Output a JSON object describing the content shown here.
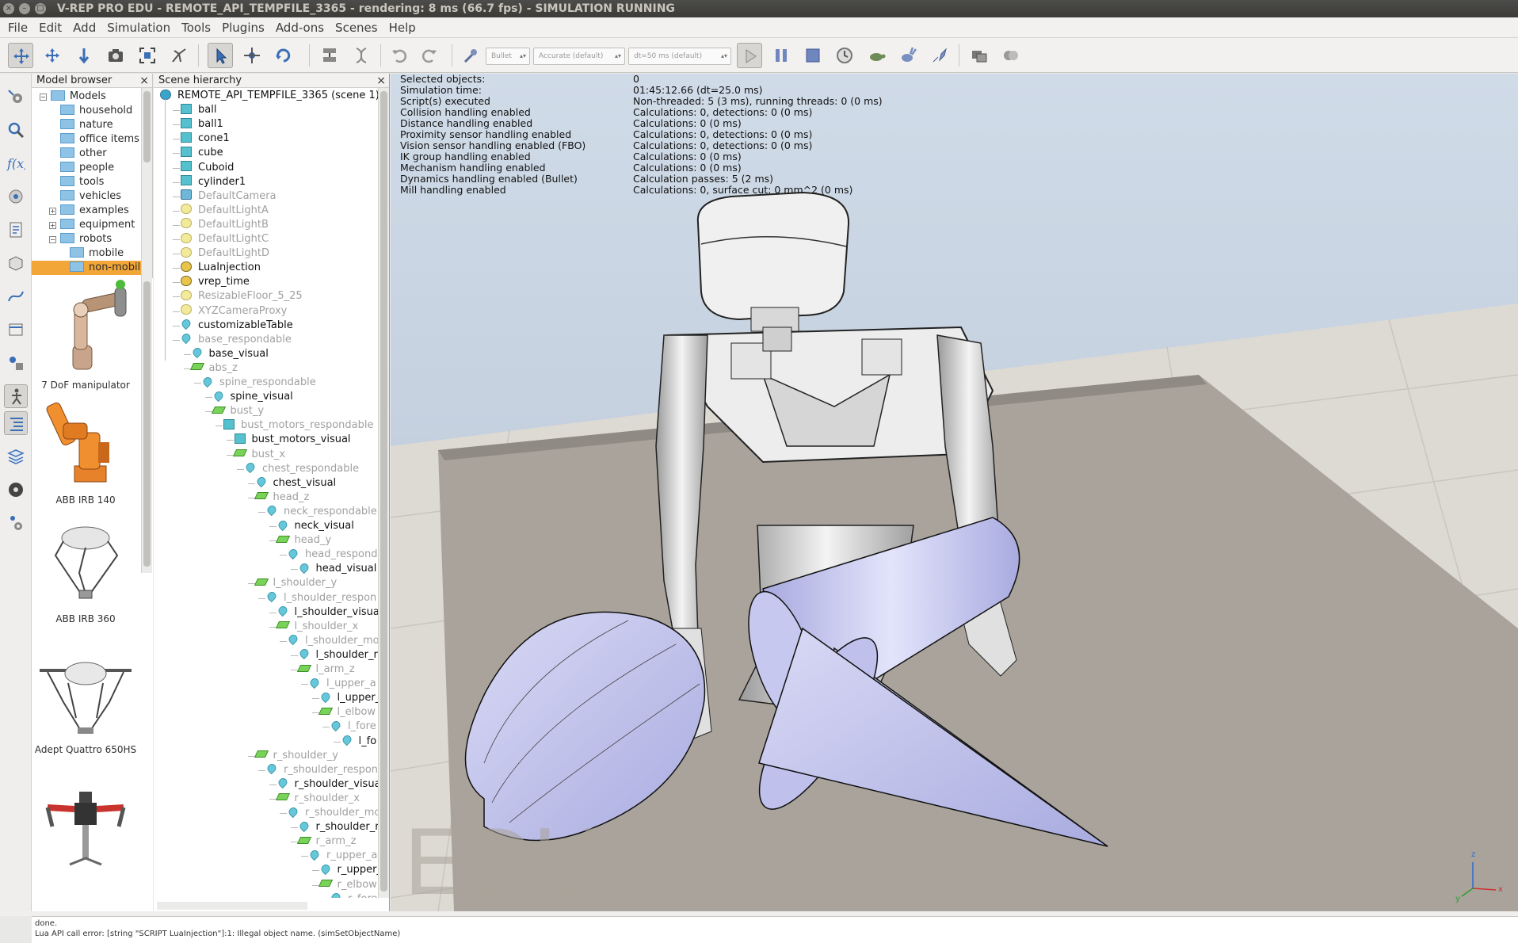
{
  "window": {
    "title": "V-REP PRO EDU - REMOTE_API_TEMPFILE_3365 - rendering: 8 ms (66.7 fps) - SIMULATION RUNNING",
    "close": "×",
    "minimize": "–",
    "maximize": "□"
  },
  "menu": [
    "File",
    "Edit",
    "Add",
    "Simulation",
    "Tools",
    "Plugins",
    "Add-ons",
    "Scenes",
    "Help"
  ],
  "toolbar": {
    "engine": "Bullet",
    "accuracy": "Accurate (default)",
    "timestep": "dt=50 ms (default)",
    "buttons": [
      "camera-pan-icon",
      "camera-rotate-icon",
      "camera-shift-icon",
      "camera-angle-icon",
      "fit-to-view-icon",
      "manipulate-icon",
      "click-select-icon",
      "object-shift-icon",
      "object-rotate-icon",
      "assemble-icon",
      "transfer-dna-icon",
      "undo-icon",
      "redo-icon",
      "dynamics-icon",
      "start-icon",
      "pause-icon",
      "stop-icon",
      "realtime-icon",
      "slower-icon",
      "faster-icon",
      "threaded-rendering-icon",
      "scene-switch-icon",
      "visualization-icon"
    ]
  },
  "model_browser": {
    "title": "Model browser",
    "close": "×",
    "folders": [
      {
        "label": "Models",
        "indent": 0,
        "expanded": true
      },
      {
        "label": "household",
        "indent": 1
      },
      {
        "label": "nature",
        "indent": 1
      },
      {
        "label": "office items",
        "indent": 1
      },
      {
        "label": "other",
        "indent": 1
      },
      {
        "label": "people",
        "indent": 1
      },
      {
        "label": "tools",
        "indent": 1
      },
      {
        "label": "vehicles",
        "indent": 1
      },
      {
        "label": "examples",
        "indent": 1,
        "collapsed": true
      },
      {
        "label": "equipment",
        "indent": 1,
        "collapsed": true
      },
      {
        "label": "robots",
        "indent": 1,
        "expanded": true
      },
      {
        "label": "mobile",
        "indent": 2
      },
      {
        "label": "non-mobile",
        "indent": 2,
        "selected": true
      }
    ],
    "thumbnails": [
      "7 DoF manipulator",
      "ABB IRB 140",
      "ABB IRB 360",
      "Adept Quattro 650HS",
      ""
    ]
  },
  "scene_hierarchy": {
    "title": "Scene hierarchy",
    "close": "×",
    "rows": [
      {
        "label": "REMOTE_API_TEMPFILE_3365 (scene 1)",
        "icon": "scene",
        "depth": 0
      },
      {
        "label": "ball",
        "icon": "shape",
        "depth": 1
      },
      {
        "label": "ball1",
        "icon": "shape",
        "depth": 1
      },
      {
        "label": "cone1",
        "icon": "shape",
        "depth": 1
      },
      {
        "label": "cube",
        "icon": "shape",
        "depth": 1
      },
      {
        "label": "Cuboid",
        "icon": "shape",
        "depth": 1
      },
      {
        "label": "cylinder1",
        "icon": "shape",
        "depth": 1
      },
      {
        "label": "DefaultCamera",
        "icon": "camera",
        "depth": 1,
        "dim": true
      },
      {
        "label": "DefaultLightA",
        "icon": "light",
        "depth": 1,
        "dim": true
      },
      {
        "label": "DefaultLightB",
        "icon": "light",
        "depth": 1,
        "dim": true
      },
      {
        "label": "DefaultLightC",
        "icon": "light",
        "depth": 1,
        "dim": true
      },
      {
        "label": "DefaultLightD",
        "icon": "light",
        "depth": 1,
        "dim": true
      },
      {
        "label": "LuaInjection",
        "icon": "script",
        "depth": 1
      },
      {
        "label": "vrep_time",
        "icon": "script",
        "depth": 1
      },
      {
        "label": "ResizableFloor_5_25",
        "icon": "light",
        "depth": 1,
        "dim": true
      },
      {
        "label": "XYZCameraProxy",
        "icon": "light",
        "depth": 1,
        "dim": true
      },
      {
        "label": "customizableTable",
        "icon": "drop",
        "depth": 1
      },
      {
        "label": "base_respondable",
        "icon": "drop",
        "depth": 1,
        "dim": true
      },
      {
        "label": "base_visual",
        "icon": "drop",
        "depth": 2
      },
      {
        "label": "abs_z",
        "icon": "joint",
        "depth": 2,
        "dim": true
      },
      {
        "label": "spine_respondable",
        "icon": "drop",
        "depth": 3,
        "dim": true
      },
      {
        "label": "spine_visual",
        "icon": "drop",
        "depth": 4
      },
      {
        "label": "bust_y",
        "icon": "joint",
        "depth": 4,
        "dim": true
      },
      {
        "label": "bust_motors_respondable",
        "icon": "shape",
        "depth": 5,
        "dim": true
      },
      {
        "label": "bust_motors_visual",
        "icon": "shape",
        "depth": 6
      },
      {
        "label": "bust_x",
        "icon": "joint",
        "depth": 6,
        "dim": true
      },
      {
        "label": "chest_respondable",
        "icon": "drop",
        "depth": 7,
        "dim": true
      },
      {
        "label": "chest_visual",
        "icon": "drop",
        "depth": 8
      },
      {
        "label": "head_z",
        "icon": "joint",
        "depth": 8,
        "dim": true
      },
      {
        "label": "neck_respondable",
        "icon": "drop",
        "depth": 9,
        "dim": true
      },
      {
        "label": "neck_visual",
        "icon": "drop",
        "depth": 10
      },
      {
        "label": "head_y",
        "icon": "joint",
        "depth": 10,
        "dim": true
      },
      {
        "label": "head_respond",
        "icon": "drop",
        "depth": 11,
        "dim": true
      },
      {
        "label": "head_visual",
        "icon": "drop",
        "depth": 12
      },
      {
        "label": "l_shoulder_y",
        "icon": "joint",
        "depth": 8,
        "dim": true
      },
      {
        "label": "l_shoulder_respon",
        "icon": "drop",
        "depth": 9,
        "dim": true
      },
      {
        "label": "l_shoulder_visua",
        "icon": "drop",
        "depth": 10
      },
      {
        "label": "l_shoulder_x",
        "icon": "joint",
        "depth": 10,
        "dim": true
      },
      {
        "label": "l_shoulder_mo",
        "icon": "drop",
        "depth": 11,
        "dim": true
      },
      {
        "label": "l_shoulder_r",
        "icon": "drop",
        "depth": 12
      },
      {
        "label": "l_arm_z",
        "icon": "joint",
        "depth": 12,
        "dim": true
      },
      {
        "label": "l_upper_a",
        "icon": "drop",
        "depth": 13,
        "dim": true
      },
      {
        "label": "l_upper_",
        "icon": "drop",
        "depth": 14
      },
      {
        "label": "l_elbow",
        "icon": "joint",
        "depth": 14,
        "dim": true
      },
      {
        "label": "l_fore",
        "icon": "drop",
        "depth": 15,
        "dim": true
      },
      {
        "label": "l_fo",
        "icon": "drop",
        "depth": 16
      },
      {
        "label": "r_shoulder_y",
        "icon": "joint",
        "depth": 8,
        "dim": true
      },
      {
        "label": "r_shoulder_respon",
        "icon": "drop",
        "depth": 9,
        "dim": true
      },
      {
        "label": "r_shoulder_visua",
        "icon": "drop",
        "depth": 10
      },
      {
        "label": "r_shoulder_x",
        "icon": "joint",
        "depth": 10,
        "dim": true
      },
      {
        "label": "r_shoulder_mo",
        "icon": "drop",
        "depth": 11,
        "dim": true
      },
      {
        "label": "r_shoulder_r",
        "icon": "drop",
        "depth": 12
      },
      {
        "label": "r_arm_z",
        "icon": "joint",
        "depth": 12,
        "dim": true
      },
      {
        "label": "r_upper_a",
        "icon": "drop",
        "depth": 13,
        "dim": true
      },
      {
        "label": "r_upper_",
        "icon": "drop",
        "depth": 14
      },
      {
        "label": "r_elbow",
        "icon": "joint",
        "depth": 14,
        "dim": true
      },
      {
        "label": "r_fore",
        "icon": "drop",
        "depth": 15,
        "dim": true
      }
    ]
  },
  "info": [
    {
      "key": "Selected objects:",
      "value": "0"
    },
    {
      "key": "Simulation time:",
      "value": "01:45:12.66 (dt=25.0 ms)"
    },
    {
      "key": "Script(s) executed",
      "value": "Non-threaded: 5 (3 ms), running threads: 0 (0 ms)"
    },
    {
      "key": "Collision handling enabled",
      "value": "Calculations: 0, detections: 0 (0 ms)"
    },
    {
      "key": "Distance handling enabled",
      "value": "Calculations: 0 (0 ms)"
    },
    {
      "key": "Proximity sensor handling enabled",
      "value": "Calculations: 0, detections: 0 (0 ms)"
    },
    {
      "key": "Vision sensor handling enabled (FBO)",
      "value": "Calculations: 0, detections: 0 (0 ms)"
    },
    {
      "key": "IK group handling enabled",
      "value": "Calculations: 0 (0 ms)"
    },
    {
      "key": "Mechanism handling enabled",
      "value": "Calculations: 0 (0 ms)"
    },
    {
      "key": "Dynamics handling enabled (Bullet)",
      "value": "Calculation passes: 5 (2 ms)"
    },
    {
      "key": "Mill handling enabled",
      "value": "Calculations: 0, surface cut: 0 mm^2 (0 ms)"
    }
  ],
  "view": {
    "watermark": "EDU",
    "axis_labels": [
      "z",
      "x",
      "y"
    ]
  },
  "status": {
    "line1": "done.",
    "line2": "Lua API call error: [string \"SCRIPT LuaInjection\"]:1: Illegal object name. (simSetObjectName)"
  },
  "colors": {
    "object_lavender": "#b7b8e6",
    "floor": "#a8a39c",
    "tile_light": "#e6e4e0"
  }
}
